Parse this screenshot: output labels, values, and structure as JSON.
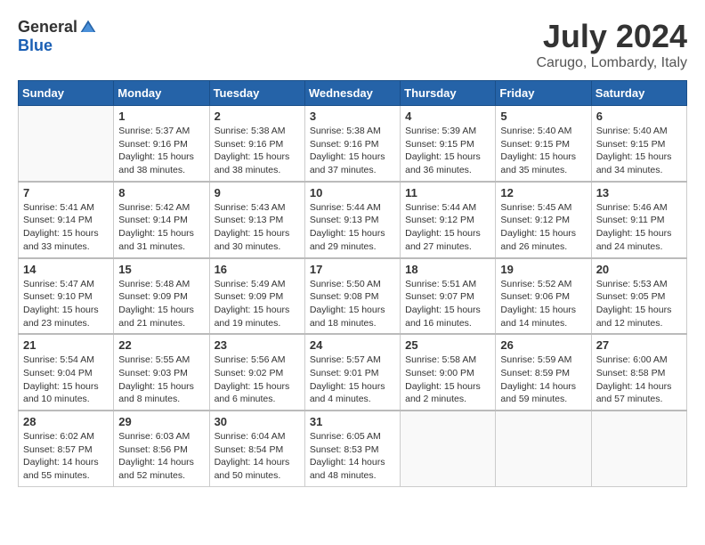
{
  "header": {
    "logo_general": "General",
    "logo_blue": "Blue",
    "month_title": "July 2024",
    "location": "Carugo, Lombardy, Italy"
  },
  "days_of_week": [
    "Sunday",
    "Monday",
    "Tuesday",
    "Wednesday",
    "Thursday",
    "Friday",
    "Saturday"
  ],
  "weeks": [
    [
      {
        "day": "",
        "info": ""
      },
      {
        "day": "1",
        "info": "Sunrise: 5:37 AM\nSunset: 9:16 PM\nDaylight: 15 hours\nand 38 minutes."
      },
      {
        "day": "2",
        "info": "Sunrise: 5:38 AM\nSunset: 9:16 PM\nDaylight: 15 hours\nand 38 minutes."
      },
      {
        "day": "3",
        "info": "Sunrise: 5:38 AM\nSunset: 9:16 PM\nDaylight: 15 hours\nand 37 minutes."
      },
      {
        "day": "4",
        "info": "Sunrise: 5:39 AM\nSunset: 9:15 PM\nDaylight: 15 hours\nand 36 minutes."
      },
      {
        "day": "5",
        "info": "Sunrise: 5:40 AM\nSunset: 9:15 PM\nDaylight: 15 hours\nand 35 minutes."
      },
      {
        "day": "6",
        "info": "Sunrise: 5:40 AM\nSunset: 9:15 PM\nDaylight: 15 hours\nand 34 minutes."
      }
    ],
    [
      {
        "day": "7",
        "info": "Sunrise: 5:41 AM\nSunset: 9:14 PM\nDaylight: 15 hours\nand 33 minutes."
      },
      {
        "day": "8",
        "info": "Sunrise: 5:42 AM\nSunset: 9:14 PM\nDaylight: 15 hours\nand 31 minutes."
      },
      {
        "day": "9",
        "info": "Sunrise: 5:43 AM\nSunset: 9:13 PM\nDaylight: 15 hours\nand 30 minutes."
      },
      {
        "day": "10",
        "info": "Sunrise: 5:44 AM\nSunset: 9:13 PM\nDaylight: 15 hours\nand 29 minutes."
      },
      {
        "day": "11",
        "info": "Sunrise: 5:44 AM\nSunset: 9:12 PM\nDaylight: 15 hours\nand 27 minutes."
      },
      {
        "day": "12",
        "info": "Sunrise: 5:45 AM\nSunset: 9:12 PM\nDaylight: 15 hours\nand 26 minutes."
      },
      {
        "day": "13",
        "info": "Sunrise: 5:46 AM\nSunset: 9:11 PM\nDaylight: 15 hours\nand 24 minutes."
      }
    ],
    [
      {
        "day": "14",
        "info": "Sunrise: 5:47 AM\nSunset: 9:10 PM\nDaylight: 15 hours\nand 23 minutes."
      },
      {
        "day": "15",
        "info": "Sunrise: 5:48 AM\nSunset: 9:09 PM\nDaylight: 15 hours\nand 21 minutes."
      },
      {
        "day": "16",
        "info": "Sunrise: 5:49 AM\nSunset: 9:09 PM\nDaylight: 15 hours\nand 19 minutes."
      },
      {
        "day": "17",
        "info": "Sunrise: 5:50 AM\nSunset: 9:08 PM\nDaylight: 15 hours\nand 18 minutes."
      },
      {
        "day": "18",
        "info": "Sunrise: 5:51 AM\nSunset: 9:07 PM\nDaylight: 15 hours\nand 16 minutes."
      },
      {
        "day": "19",
        "info": "Sunrise: 5:52 AM\nSunset: 9:06 PM\nDaylight: 15 hours\nand 14 minutes."
      },
      {
        "day": "20",
        "info": "Sunrise: 5:53 AM\nSunset: 9:05 PM\nDaylight: 15 hours\nand 12 minutes."
      }
    ],
    [
      {
        "day": "21",
        "info": "Sunrise: 5:54 AM\nSunset: 9:04 PM\nDaylight: 15 hours\nand 10 minutes."
      },
      {
        "day": "22",
        "info": "Sunrise: 5:55 AM\nSunset: 9:03 PM\nDaylight: 15 hours\nand 8 minutes."
      },
      {
        "day": "23",
        "info": "Sunrise: 5:56 AM\nSunset: 9:02 PM\nDaylight: 15 hours\nand 6 minutes."
      },
      {
        "day": "24",
        "info": "Sunrise: 5:57 AM\nSunset: 9:01 PM\nDaylight: 15 hours\nand 4 minutes."
      },
      {
        "day": "25",
        "info": "Sunrise: 5:58 AM\nSunset: 9:00 PM\nDaylight: 15 hours\nand 2 minutes."
      },
      {
        "day": "26",
        "info": "Sunrise: 5:59 AM\nSunset: 8:59 PM\nDaylight: 14 hours\nand 59 minutes."
      },
      {
        "day": "27",
        "info": "Sunrise: 6:00 AM\nSunset: 8:58 PM\nDaylight: 14 hours\nand 57 minutes."
      }
    ],
    [
      {
        "day": "28",
        "info": "Sunrise: 6:02 AM\nSunset: 8:57 PM\nDaylight: 14 hours\nand 55 minutes."
      },
      {
        "day": "29",
        "info": "Sunrise: 6:03 AM\nSunset: 8:56 PM\nDaylight: 14 hours\nand 52 minutes."
      },
      {
        "day": "30",
        "info": "Sunrise: 6:04 AM\nSunset: 8:54 PM\nDaylight: 14 hours\nand 50 minutes."
      },
      {
        "day": "31",
        "info": "Sunrise: 6:05 AM\nSunset: 8:53 PM\nDaylight: 14 hours\nand 48 minutes."
      },
      {
        "day": "",
        "info": ""
      },
      {
        "day": "",
        "info": ""
      },
      {
        "day": "",
        "info": ""
      }
    ]
  ]
}
